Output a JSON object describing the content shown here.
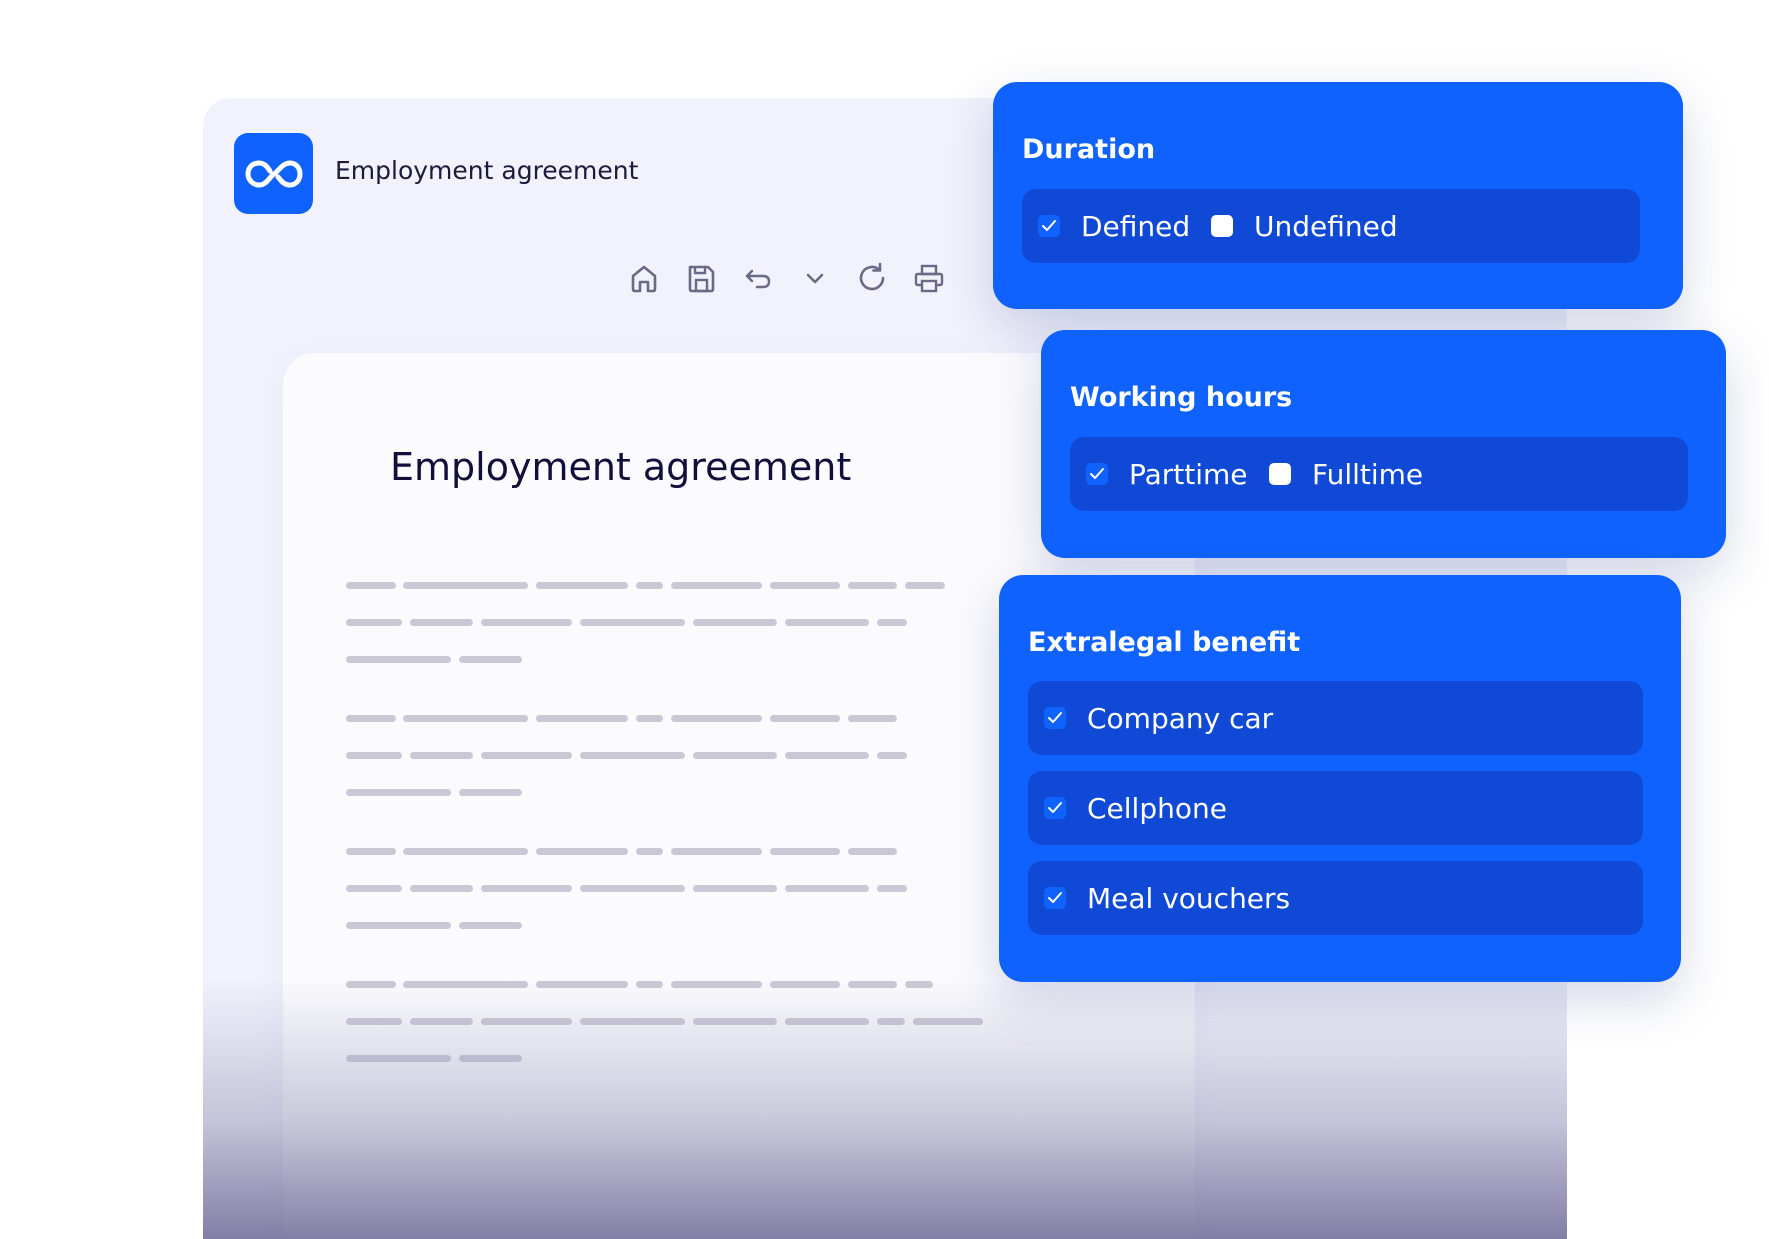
{
  "app": {
    "window_title": "Employment agreement",
    "logo_icon": "infinity-logo-icon",
    "brand_color": "#1062fe"
  },
  "toolbar": {
    "icons": [
      "home-icon",
      "save-icon",
      "undo-icon",
      "chevron-down-icon",
      "refresh-icon",
      "print-icon"
    ]
  },
  "document": {
    "title": "Employment agreement"
  },
  "panels": {
    "duration": {
      "title": "Duration",
      "options": [
        {
          "label": "Defined",
          "checked": true
        },
        {
          "label": "Undefined",
          "checked": false
        }
      ]
    },
    "working_hours": {
      "title": "Working hours",
      "options": [
        {
          "label": "Parttime",
          "checked": true
        },
        {
          "label": "Fulltime",
          "checked": false
        }
      ]
    },
    "extralegal_benefit": {
      "title": "Extralegal benefit",
      "options": [
        {
          "label": "Company car",
          "checked": true
        },
        {
          "label": "Cellphone",
          "checked": true
        },
        {
          "label": "Meal vouchers",
          "checked": true
        }
      ]
    }
  }
}
